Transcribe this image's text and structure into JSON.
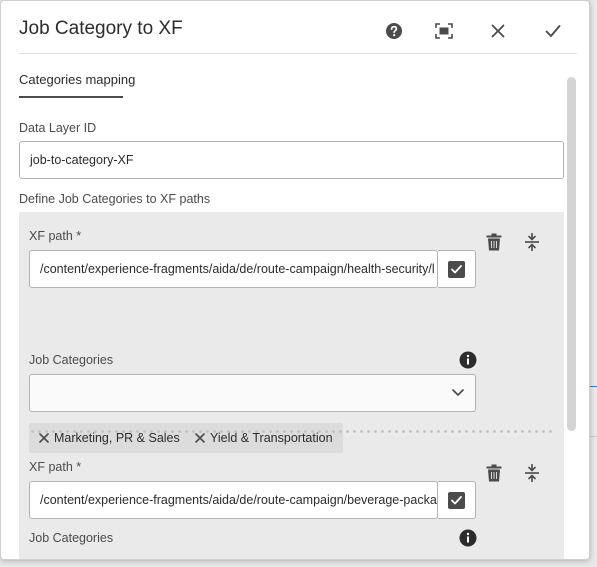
{
  "dialog": {
    "title": "Job Category to XF",
    "help_label": "Help",
    "fullscreen_label": "Toggle fullscreen",
    "close_label": "Close",
    "done_label": "Done"
  },
  "tabs": [
    {
      "label": "Categories mapping",
      "selected": true
    }
  ],
  "data_layer": {
    "label": "Data Layer ID",
    "value": "job-to-category-XF"
  },
  "mapping_section": {
    "label": "Define Job Categories to XF paths",
    "items": [
      {
        "xf_label": "XF path *",
        "xf_value": "/content/experience-fragments/aida/de/route-campaign/health-security/l",
        "categories_label": "Job Categories",
        "categories_placeholder": "",
        "tags": [
          "Marketing, PR & Sales",
          "Yield & Transportation"
        ]
      },
      {
        "xf_label": "XF path *",
        "xf_value": "/content/experience-fragments/aida/de/route-campaign/beverage-packa",
        "categories_label": "Job Categories"
      }
    ]
  },
  "colors": {
    "accent_line": "#2680eb",
    "multifield_bg": "#eaeaea",
    "tag_bg": "#dcdcdc",
    "icon": "#4b4b4b"
  },
  "icons": [
    "help-icon",
    "fullscreen-icon",
    "close-icon",
    "checkmark-icon",
    "delete-icon",
    "reorder-icon",
    "info-icon",
    "chevron-down-icon",
    "tag-remove-icon",
    "checkbox-checked-icon"
  ],
  "background_fragments": [
    ")",
    "F"
  ]
}
